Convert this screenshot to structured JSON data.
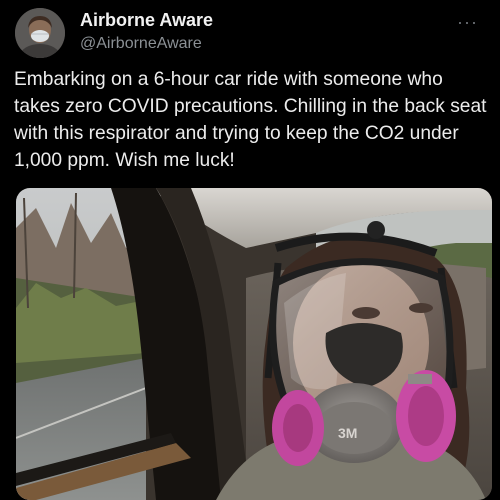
{
  "post": {
    "author_name": "Airborne Aware",
    "author_handle": "@AirborneAware",
    "more_icon": "more-horizontal-icon",
    "text": "Embarking on a 6-hour car ride with someone who takes zero COVID precautions. Chilling in the back seat with this respirator and trying to keep the CO2 under 1,000 ppm. Wish me luck!",
    "media": {
      "respirator_brand": "3M"
    }
  },
  "colors": {
    "background": "#000000",
    "text": "#e7e9ea",
    "secondary_text": "#8b9095",
    "filter_magenta": "#c2479e"
  }
}
